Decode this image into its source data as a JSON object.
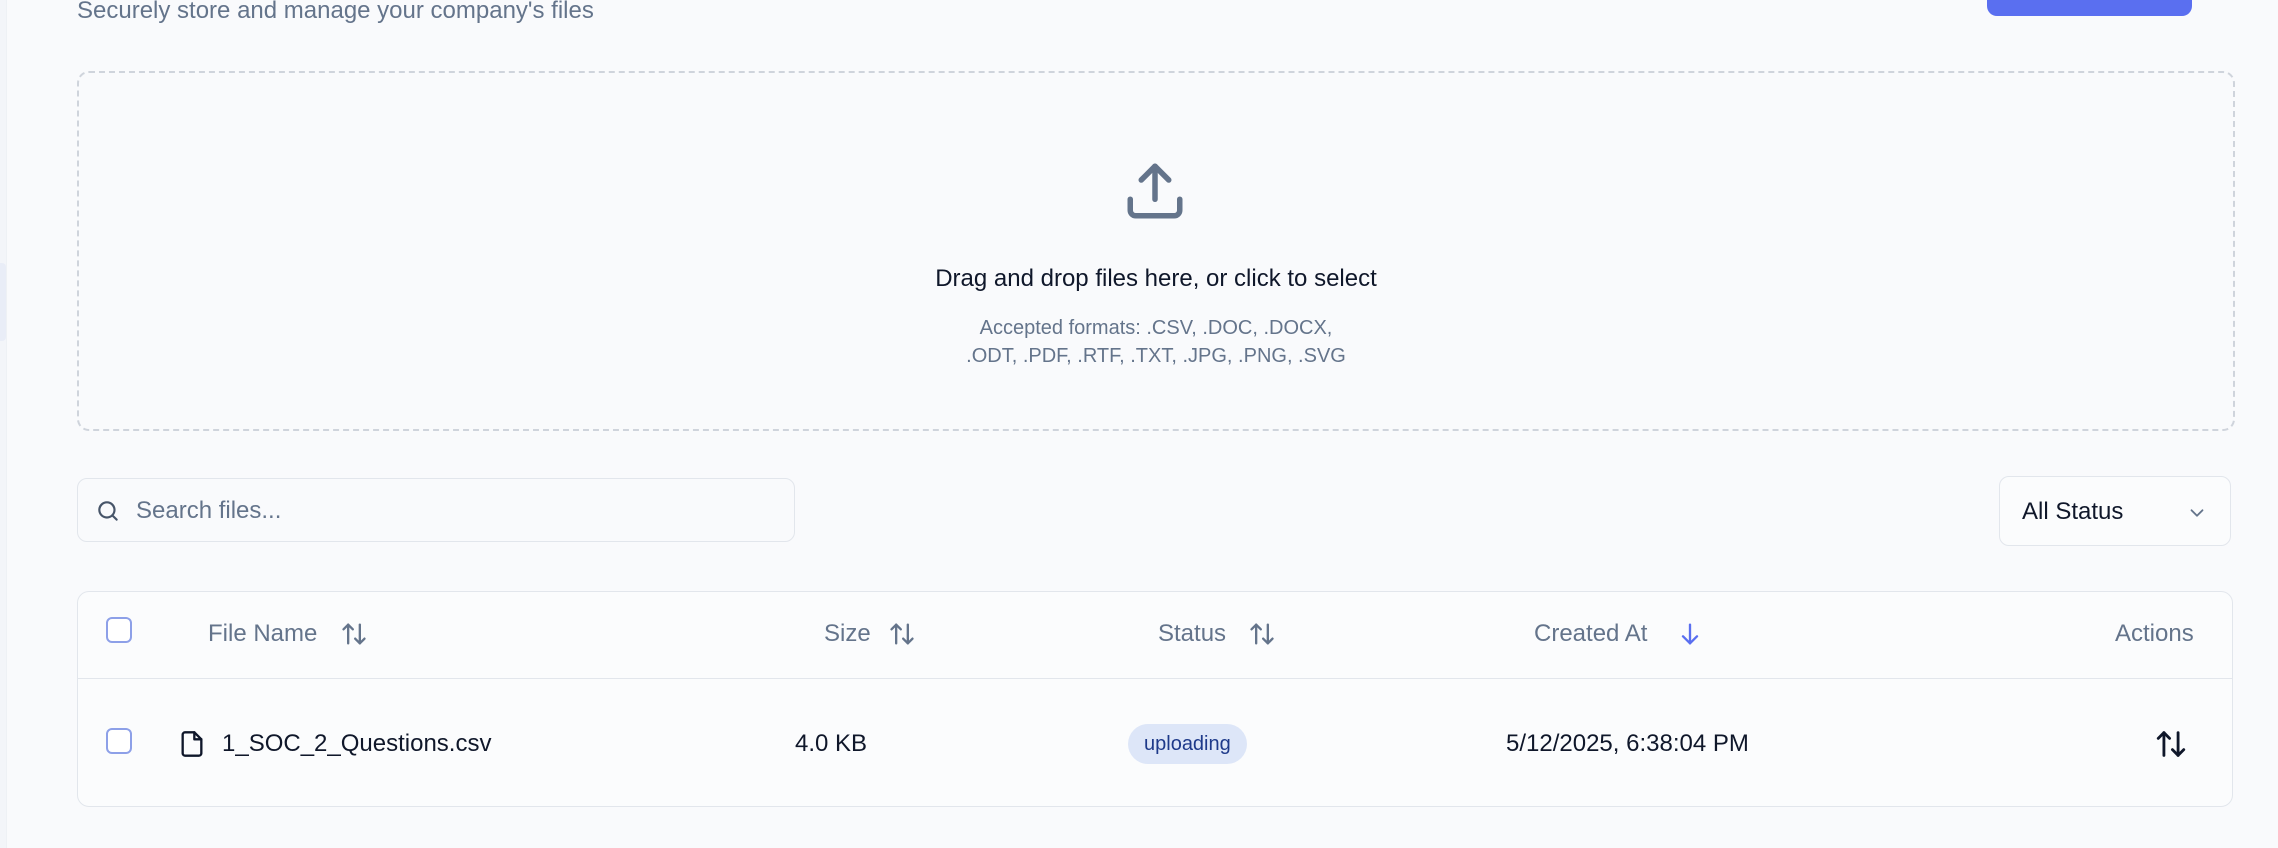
{
  "header": {
    "subtitle": "Securely store and manage your company's files"
  },
  "dropzone": {
    "icon": "upload-icon",
    "title": "Drag and drop files here, or click to select",
    "formats_line1": "Accepted formats: .CSV, .DOC, .DOCX,",
    "formats_line2": ".ODT, .PDF, .RTF, .TXT, .JPG, .PNG, .SVG"
  },
  "search": {
    "placeholder": "Search files...",
    "value": ""
  },
  "filter": {
    "selected": "All Status"
  },
  "table": {
    "columns": [
      {
        "label": "File Name",
        "sort_icon": "sort-both-icon"
      },
      {
        "label": "Size",
        "sort_icon": "sort-both-icon"
      },
      {
        "label": "Status",
        "sort_icon": "sort-both-icon"
      },
      {
        "label": "Created At",
        "sort_icon": "sort-desc-icon"
      },
      {
        "label": "Actions"
      }
    ],
    "rows": [
      {
        "file_name": "1_SOC_2_Questions.csv",
        "size": "4.0 KB",
        "status": "uploading",
        "created_at": "5/12/2025, 6:38:04 PM",
        "action_icon": "sort-both-icon"
      }
    ]
  },
  "colors": {
    "accent": "#5a6ff0",
    "badge_bg": "#dde6f8",
    "badge_text": "#1e3a8a",
    "muted_text": "#64748b",
    "border": "#e2e6ec"
  }
}
